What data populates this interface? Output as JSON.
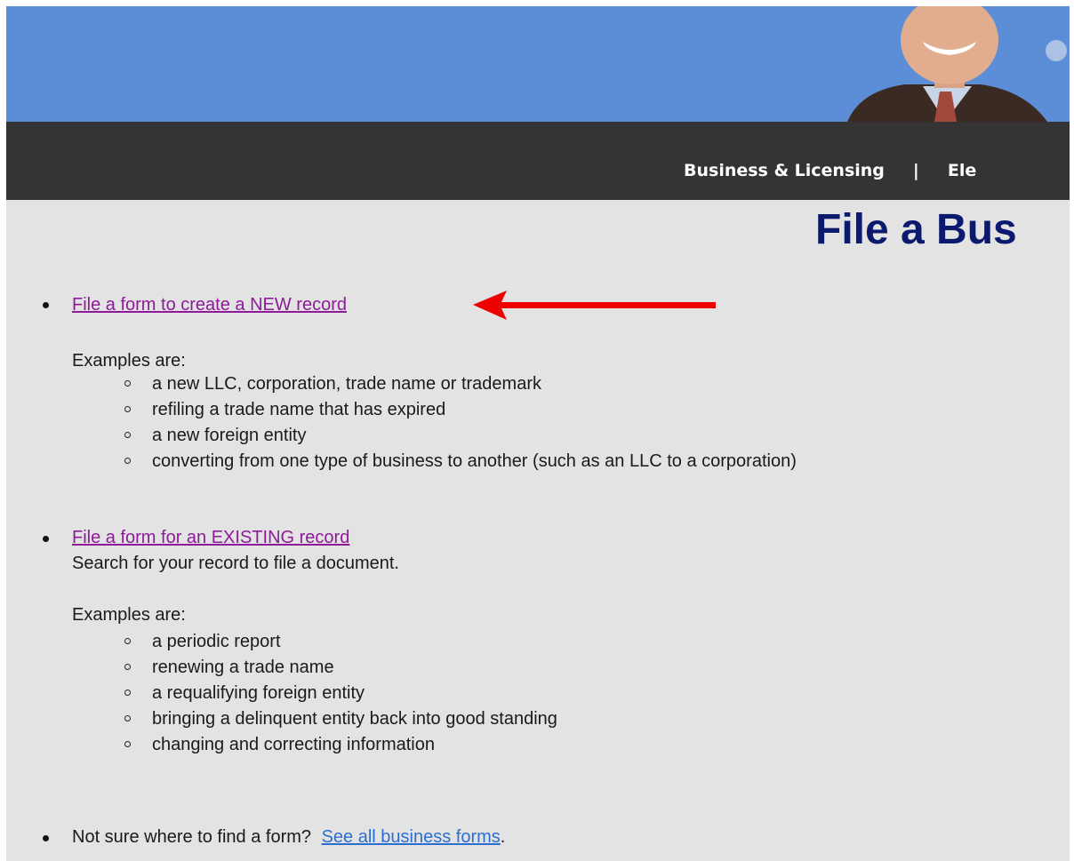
{
  "nav": {
    "business_licensing": "Business & Licensing",
    "separator": "|",
    "next_partial": "Ele"
  },
  "page_title": "File a Bus",
  "section_new": {
    "link": "File a form to create a NEW record",
    "examples_label": "Examples are:",
    "examples": [
      "a new LLC, corporation, trade name or trademark",
      "refiling a trade name that has expired",
      "a new foreign entity",
      "converting from one type of business to another (such as an LLC to a corporation)"
    ]
  },
  "section_existing": {
    "link": "File a form for an EXISTING record",
    "description": "Search for your record to file a document.",
    "examples_label": "Examples are:",
    "examples": [
      "a periodic report",
      "renewing a trade name",
      "a requalifying foreign entity",
      "bringing a delinquent entity back into good standing",
      "changing and correcting information"
    ]
  },
  "section_all": {
    "prompt": "Not sure where to find a form?",
    "link": "See all business forms",
    "suffix": "."
  },
  "colors": {
    "banner": "#5b8ed6",
    "navbar": "#343434",
    "page_background": "#e3e3e3",
    "title": "#0b1a6e",
    "visited_link": "#8e1a9a",
    "link": "#2a6fd0",
    "annotation_arrow": "#ee0000"
  },
  "icons": [
    "portrait-photo",
    "red-arrow-icon"
  ]
}
